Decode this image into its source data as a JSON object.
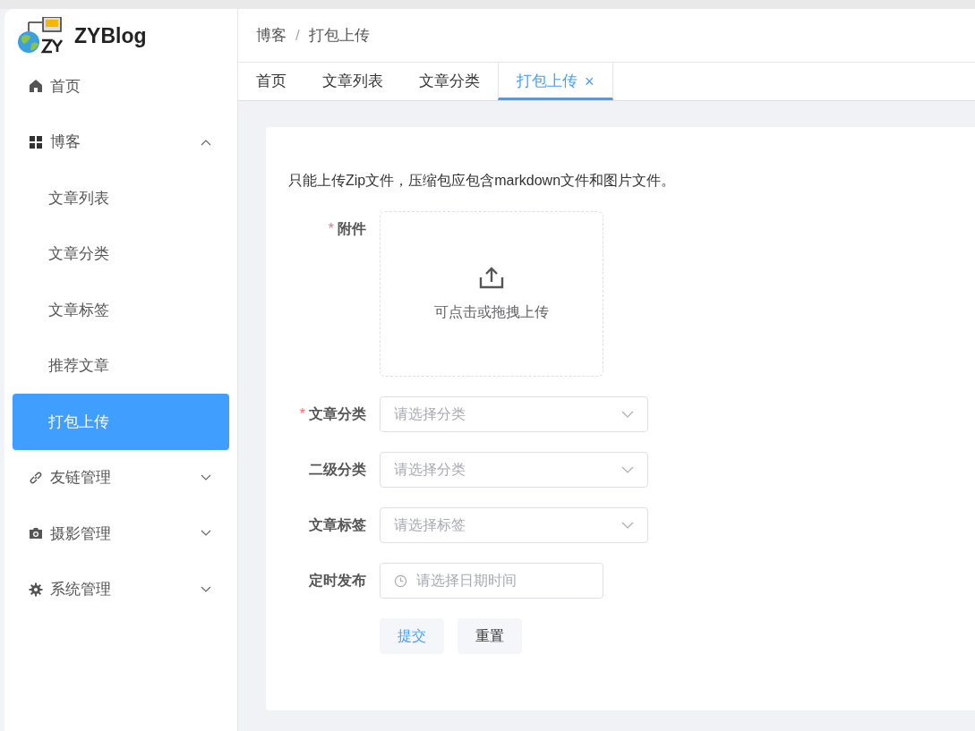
{
  "logo": {
    "text": "ZYBlog"
  },
  "sidebar": {
    "items": [
      {
        "label": "首页",
        "selected": false
      },
      {
        "label": "博客",
        "expanded": true,
        "selected": false,
        "children": [
          {
            "label": "文章列表",
            "selected": false
          },
          {
            "label": "文章分类",
            "selected": false
          },
          {
            "label": "文章标签",
            "selected": false
          },
          {
            "label": "推荐文章",
            "selected": false
          },
          {
            "label": "打包上传",
            "selected": true
          }
        ]
      },
      {
        "label": "友链管理",
        "expanded": false,
        "selected": false
      },
      {
        "label": "摄影管理",
        "expanded": false,
        "selected": false
      },
      {
        "label": "系统管理",
        "expanded": false,
        "selected": false
      }
    ]
  },
  "breadcrumb": {
    "items": [
      "博客",
      "打包上传"
    ],
    "separator": "/"
  },
  "tabs": [
    {
      "label": "首页",
      "selected": false,
      "closable": false
    },
    {
      "label": "文章列表",
      "selected": false,
      "closable": false
    },
    {
      "label": "文章分类",
      "selected": false,
      "closable": false
    },
    {
      "label": "打包上传",
      "selected": true,
      "closable": true,
      "close": "×"
    }
  ],
  "form": {
    "note": "只能上传Zip文件，压缩包应包含markdown文件和图片文件。",
    "fields": [
      {
        "kind": "upload",
        "label": "附件",
        "required_mark": "*",
        "hint": "可点击或拖拽上传"
      },
      {
        "kind": "select",
        "label": "文章分类",
        "required_mark": "*",
        "placeholder": "请选择分类"
      },
      {
        "kind": "select",
        "label": "二级分类",
        "placeholder": "请选择分类"
      },
      {
        "kind": "select",
        "label": "文章标签",
        "placeholder": "请选择标签"
      },
      {
        "kind": "datetime",
        "label": "定时发布",
        "placeholder": "请选择日期时间"
      }
    ],
    "buttons": [
      {
        "label": "提交",
        "kind": "primary"
      },
      {
        "label": "重置",
        "kind": "plain"
      }
    ]
  }
}
